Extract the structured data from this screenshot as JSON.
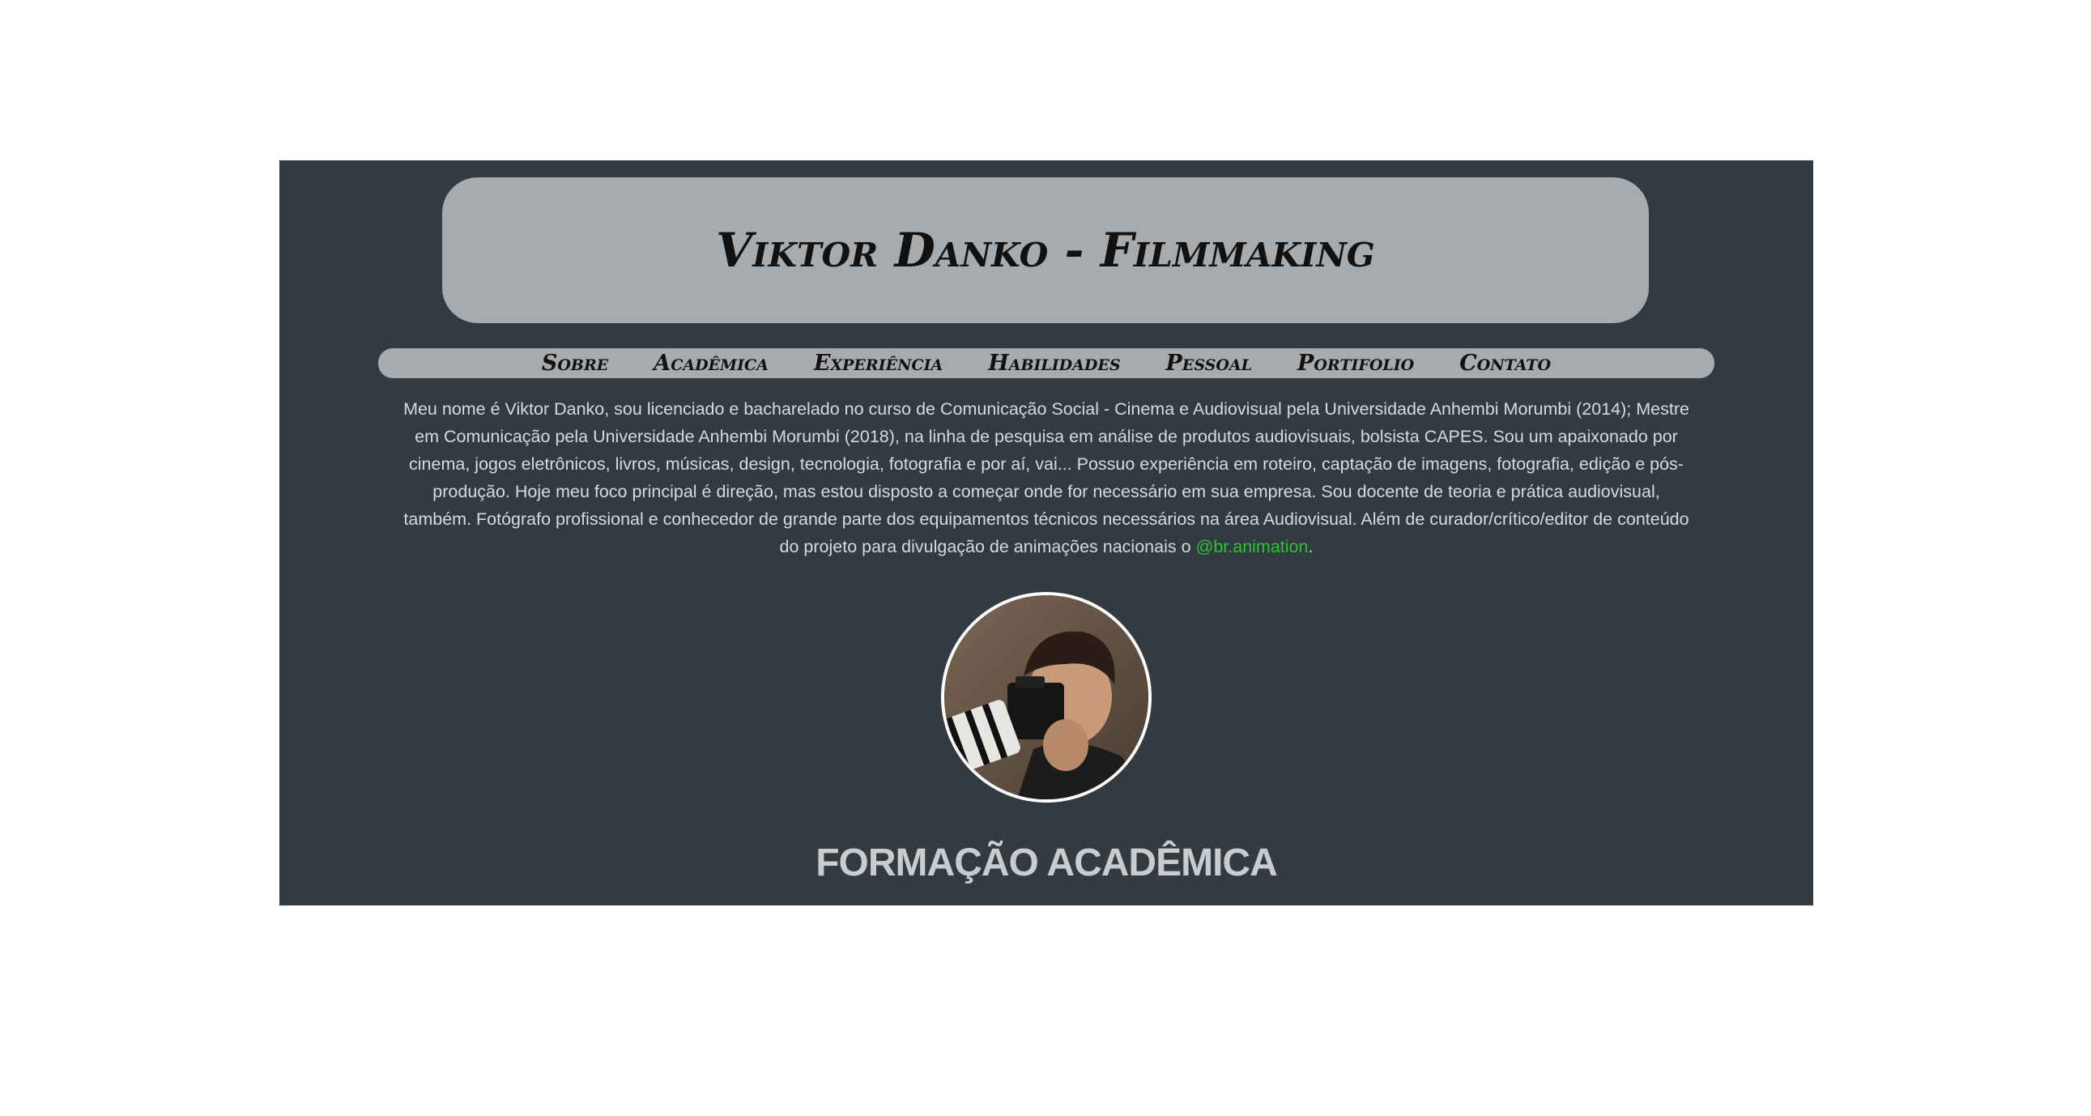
{
  "header": {
    "title": "Viktor Danko - Filmmaking"
  },
  "nav": {
    "items": [
      {
        "label": "Sobre"
      },
      {
        "label": "Acadêmica"
      },
      {
        "label": "Experiência"
      },
      {
        "label": "Habilidades"
      },
      {
        "label": "Pessoal"
      },
      {
        "label": "Portifolio"
      },
      {
        "label": "Contato"
      }
    ]
  },
  "about": {
    "text": "Meu nome é Viktor Danko, sou licenciado e bacharelado no curso de Comunicação Social - Cinema e Audiovisual pela Universidade Anhembi Morumbi (2014); Mestre em Comunicação pela Universidade Anhembi Morumbi (2018), na linha de pesquisa em análise de produtos audiovisuais, bolsista CAPES. Sou um apaixonado por cinema, jogos eletrônicos, livros, músicas, design, tecnologia, fotografia e por aí, vai... Possuo experiência em roteiro, captação de imagens, fotografia, edição e pós-produção. Hoje meu foco principal é direção, mas estou disposto a começar onde for necessário em sua empresa. Sou docente de teoria e prática audiovisual, também. Fotógrafo profissional e conhecedor de grande parte dos equipamentos técnicos necessários na área Audiovisual. Além de curador/crítico/editor de conteúdo do projeto para divulgação de animações nacionais o",
    "link_label": "@br.animation",
    "trailing": "."
  },
  "sections": {
    "academic_title": "FORMAÇÃO ACADÊMICA"
  },
  "colors": {
    "page_bg": "#ffffff",
    "panel_bg": "#323a42",
    "header_bg": "#a8abae",
    "link": "#2cc52c",
    "body_text": "#d8dadb"
  }
}
